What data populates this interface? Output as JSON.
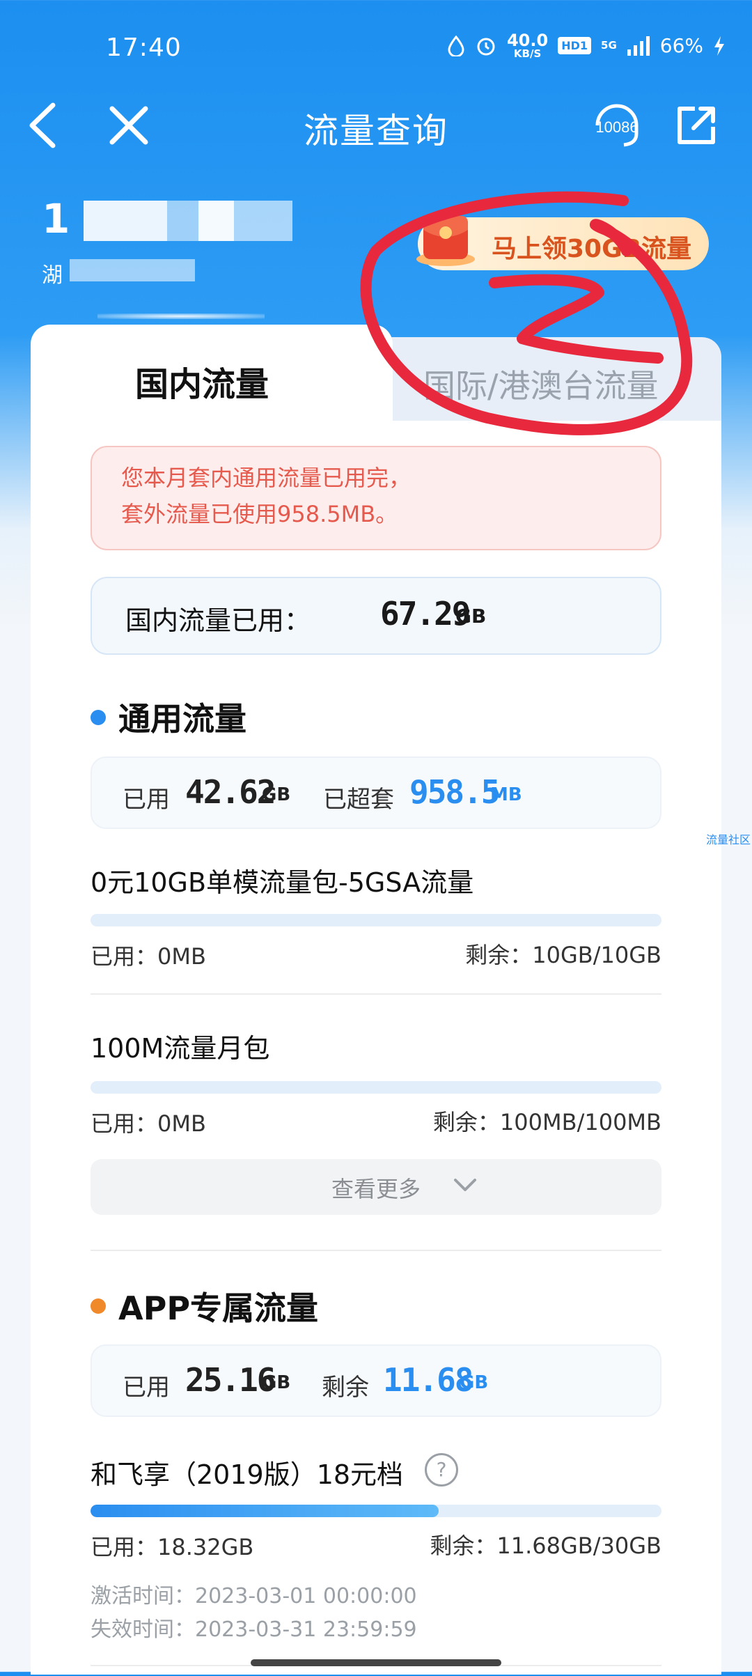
{
  "status_bar": {
    "time": "17:40",
    "net_speed_value": "40.0",
    "net_speed_unit": "KB/S",
    "hd_label": "HD1",
    "network": "5G",
    "battery": "66%"
  },
  "nav": {
    "title": "流量查询",
    "service_number": "10086"
  },
  "account": {
    "phone_prefix": "1",
    "region_prefix": "湖"
  },
  "promo": {
    "label": "马上领30GB流量"
  },
  "tabs": [
    {
      "label": "国内流量",
      "active": true
    },
    {
      "label": "国际/港澳台流量",
      "active": false
    }
  ],
  "alert": {
    "text": "您本月套内通用流量已用完，套外流量已使用958.5MB。"
  },
  "domestic": {
    "label": "国内流量已用：",
    "value": "67.29",
    "unit": "GB"
  },
  "general": {
    "title": "通用流量",
    "dot_color": "#2a8ef0",
    "used_label": "已用",
    "used_value": "42.62",
    "used_unit": "GB",
    "over_label": "已超套",
    "over_value": "958.5",
    "over_unit": "MB",
    "packages": [
      {
        "name": "0元10GB单模流量包-5GSA流量",
        "used": "已用：0MB",
        "remain": "剩余：10GB/10GB",
        "fraction": 0
      },
      {
        "name": "100M流量月包",
        "used": "已用：0MB",
        "remain": "剩余：100MB/100MB",
        "fraction": 0
      }
    ],
    "more_label": "查看更多"
  },
  "app": {
    "title": "APP专属流量",
    "dot_color": "#f0892a",
    "used_label": "已用",
    "used_value": "25.16",
    "used_unit": "GB",
    "remain_label": "剩余",
    "remain_value": "11.68",
    "remain_unit": "GB",
    "package": {
      "name": "和飞享（2019版）18元档",
      "help": "?",
      "used": "已用：18.32GB",
      "remain": "剩余：11.68GB/30GB",
      "fraction": 0.61,
      "activated": "激活时间：2023-03-01 00:00:00",
      "expires": "失效时间：2023-03-31 23:59:59"
    }
  },
  "side_link": "流量社区",
  "colors": {
    "primary": "#1c8ff0",
    "accent_blue": "#2a8ef0",
    "alert_text": "#e65a4e",
    "promo_text": "#d9531e",
    "annotation_red": "#e8283c"
  }
}
